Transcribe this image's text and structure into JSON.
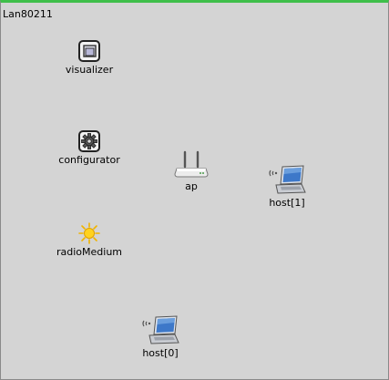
{
  "network": {
    "title": "Lan80211"
  },
  "nodes": {
    "visualizer": {
      "label": "visualizer",
      "icon": "visualizer-icon"
    },
    "configurator": {
      "label": "configurator",
      "icon": "gear-icon"
    },
    "radioMedium": {
      "label": "radioMedium",
      "icon": "sun-icon"
    },
    "ap": {
      "label": "ap",
      "icon": "router-icon"
    },
    "host1": {
      "label": "host[1]",
      "icon": "laptop-icon"
    },
    "host0": {
      "label": "host[0]",
      "icon": "laptop-icon"
    }
  },
  "colors": {
    "canvas": "#d4d4d4",
    "top_border": "#3fbf4a"
  }
}
